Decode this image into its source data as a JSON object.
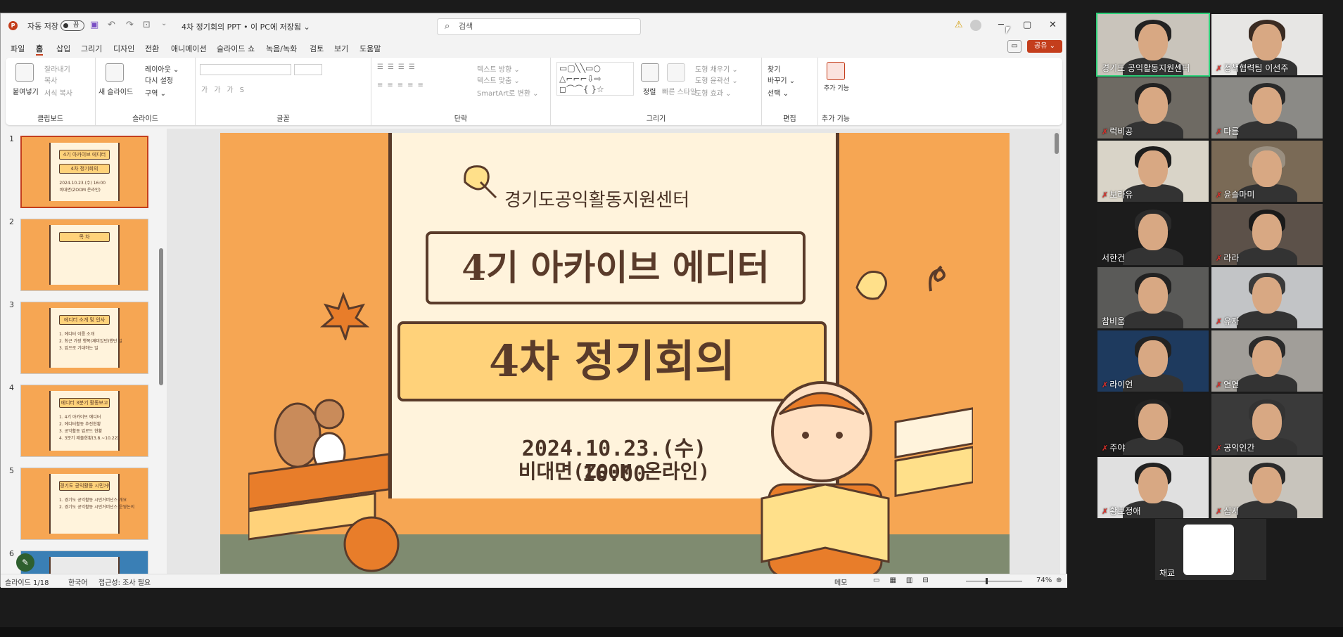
{
  "app": {
    "autosave_label": "자동 저장",
    "autosave_state": "끔",
    "doc_title": "4차 정기회의 PPT • 이 PC에 저장됨 ⌄",
    "search_placeholder": "검색",
    "win_min": "─",
    "win_max": "▢",
    "win_close": "✕"
  },
  "menu": {
    "items": [
      "파일",
      "홈",
      "삽입",
      "그리기",
      "디자인",
      "전환",
      "애니메이션",
      "슬라이드 쇼",
      "녹음/녹화",
      "검토",
      "보기",
      "도움말"
    ],
    "share": "공유 ⌄"
  },
  "ribbon": {
    "clipboard": {
      "label": "클립보드",
      "paste": "붙여넣기",
      "cut": "잘라내기",
      "copy": "복사",
      "format_painter": "서식 복사"
    },
    "slides": {
      "label": "슬라이드",
      "new_slide": "새 슬라이드",
      "layout": "레이아웃 ⌄",
      "reset": "다시 설정",
      "section": "구역 ⌄"
    },
    "font": {
      "label": "글꼴"
    },
    "paragraph": {
      "label": "단락",
      "text_direction": "텍스트 방향 ⌄",
      "align_text": "텍스트 맞춤 ⌄",
      "smartart": "SmartArt로 변환 ⌄"
    },
    "drawing": {
      "label": "그리기",
      "arrange": "정렬",
      "quick_styles": "빠른 스타일",
      "shape_fill": "도형 채우기 ⌄",
      "shape_outline": "도형 윤곽선 ⌄",
      "shape_effects": "도형 효과 ⌄"
    },
    "editing": {
      "label": "편집",
      "find": "찾기",
      "replace": "바꾸기 ⌄",
      "select": "선택 ⌄"
    },
    "addins": {
      "label": "추가 기능",
      "addins": "추가 기능"
    }
  },
  "thumbnails": [
    {
      "num": "1",
      "title": "4기 아카이브 에디터",
      "sub": "4차 정기회의",
      "lines": [
        "2024.10.23.(수) 16:00",
        "비대면(ZOOM 온라인)"
      ]
    },
    {
      "num": "2",
      "title": "목 차",
      "sub": "",
      "lines": [
        "",
        "",
        ""
      ]
    },
    {
      "num": "3",
      "title": "에디터 소개 및 인사",
      "sub": "",
      "lines": [
        "1. 에디터 이름 소개",
        "2. 최근 가장 행복(재미있던)했던 일",
        "3. 앞으로 기대하는 일"
      ]
    },
    {
      "num": "4",
      "title": "에디터 3분기 활동보고",
      "sub": "",
      "lines": [
        "1. 4기 아카이브 에디터",
        "2. 에디터활동 추진현황",
        "3. 공익활동 업로드 현황",
        "4. 3분기 제출현황(3.8.~10.22)"
      ]
    },
    {
      "num": "5",
      "title": "경기도 공익활동 시민거버넌스 제안계획",
      "sub": "",
      "lines": [
        "1. 경기도 공익활동 시민거버넌스 개요",
        "2. 경기도 공익활동 시민거버넌스 운영논의"
      ]
    },
    {
      "num": "6",
      "title": "",
      "sub": "",
      "lines": []
    }
  ],
  "slide": {
    "org": "경기도공익활동지원센터",
    "title1": "4기 아카이브 에디터",
    "title2": "4차 정기회의",
    "date": "2024.10.23.(수) 16:00",
    "venue": "비대면(ZOOM 온라인)"
  },
  "status": {
    "slide_pos": "슬라이드 1/18",
    "language": "한국어",
    "accessibility": "접근성: 조사 필요",
    "notes": "메모",
    "zoom": "74%"
  },
  "participants": [
    {
      "name": "경기도 공익활동지원센터",
      "muted": false
    },
    {
      "name": "정책협력팀 이선주",
      "muted": true
    },
    {
      "name": "럭비공",
      "muted": true
    },
    {
      "name": "다름",
      "muted": true
    },
    {
      "name": "보라유",
      "muted": true
    },
    {
      "name": "윤슬마미",
      "muted": true
    },
    {
      "name": "서한건",
      "muted": false
    },
    {
      "name": "라라",
      "muted": true
    },
    {
      "name": "참비움",
      "muted": false
    },
    {
      "name": "유자",
      "muted": true
    },
    {
      "name": "라이언",
      "muted": true
    },
    {
      "name": "연연",
      "muted": true
    },
    {
      "name": "주야",
      "muted": true
    },
    {
      "name": "공익인간",
      "muted": true
    },
    {
      "name": "황보정애",
      "muted": true
    },
    {
      "name": "심지",
      "muted": true
    },
    {
      "name": "채쿄",
      "muted": false
    }
  ],
  "colors": {
    "accent": "#c43e1c",
    "slide_orange": "#f6a653",
    "slide_cream": "#fff3dc",
    "slide_brown": "#5a3b2a",
    "active_speaker": "#2fd07a"
  }
}
